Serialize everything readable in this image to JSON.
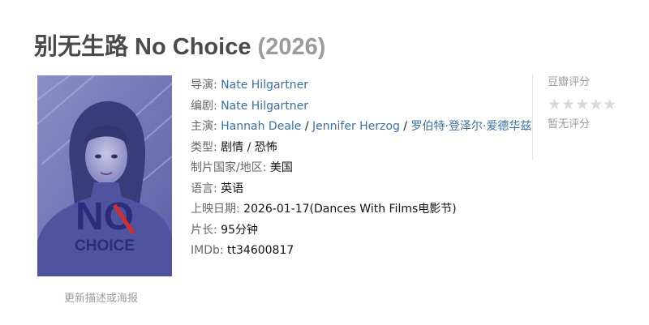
{
  "header": {
    "title": "别无生路 No Choice",
    "year": "(2026)"
  },
  "poster": {
    "line1": "NO",
    "line2": "CHOICE",
    "tint": "#5a63b3",
    "accent": "#d32f2f"
  },
  "update_link": "更新描述或海报",
  "info": {
    "director_label": "导演:",
    "director": "Nate Hilgartner",
    "writer_label": "编剧:",
    "writer": "Nate Hilgartner",
    "cast_label": "主演:",
    "cast": [
      "Hannah Deale",
      "Jennifer Herzog",
      "罗伯特·登泽尔·爱德华兹"
    ],
    "cast_sep": " / ",
    "genre_label": "类型:",
    "genres": [
      "剧情",
      "恐怖"
    ],
    "country_label": "制片国家/地区:",
    "country": "美国",
    "language_label": "语言:",
    "language": "英语",
    "release_label": "上映日期:",
    "release": "2026-01-17(Dances With Films电影节)",
    "runtime_label": "片长:",
    "runtime": "95分钟",
    "imdb_label": "IMDb:",
    "imdb": "tt34600817"
  },
  "rating": {
    "title": "豆瓣评分",
    "stars": "★★★★★",
    "no_rating": "暂无评分"
  },
  "colors": {
    "link": "#3a6fa6",
    "muted": "#9a9a9a"
  }
}
